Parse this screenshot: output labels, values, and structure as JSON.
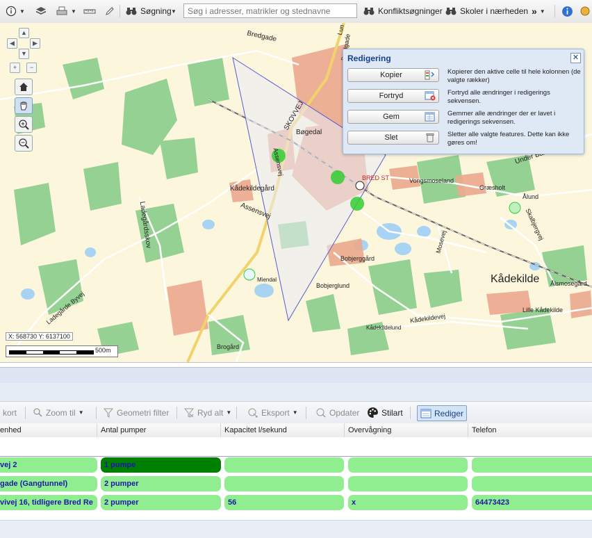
{
  "toolbar": {
    "search_label": "Søgning",
    "search_placeholder": "Søg i adresser, matrikler og stednavne",
    "conflict_label": "Konfliktsøgninger",
    "schools_label": "Skoler i nærheden",
    "more_label": "»"
  },
  "map": {
    "labels": {
      "bredgade": "Bredgade",
      "skovvej": "SKOVVEJ",
      "bogedal": "Bøgedal",
      "assensvej_v": "Assensvej",
      "bred_st": "BRED ST",
      "vongsmoseland": "Vongsmoseland",
      "graesholt": "Græsholt",
      "alund": "Ålund",
      "under_banken": "Under Banken",
      "kadekildegard": "Kådekildegård",
      "assensvej": "Assensvej",
      "ladegardsskov": "Ladegårdsskov",
      "kadekilde": "Kådekilde",
      "alsmosegard": "Ålsmosegård",
      "lille_kadekilde": "Lille Kådekilde",
      "bobjerggard": "Bobjerggård",
      "bobjerglund": "Bobjerglund",
      "miendal": "Miendal",
      "mosevej": "Mosevej",
      "ladegarde_byvej": "Ladegårde Byvej",
      "kadekildevej": "Kådekildevej",
      "kadekildelund": "Kådekildelund",
      "brogard": "Brogård",
      "skalbjergvej": "Skalbjergvej",
      "bredgade_n": "Bredgade",
      "lun": "Lun"
    },
    "coords": "X: 568730 Y: 6137100",
    "scale": "500m"
  },
  "edit_panel": {
    "title": "Redigering",
    "buttons": [
      {
        "label": "Kopier",
        "desc": "Kopierer den aktive celle til hele kolonnen (de valgte rækker)"
      },
      {
        "label": "Fortryd",
        "desc": "Fortryd alle ændringer i redigerings sekvensen."
      },
      {
        "label": "Gem",
        "desc": "Gemmer alle ændringer der er lavet i redigerings sekvensen."
      },
      {
        "label": "Slet",
        "desc": "Sletter alle valgte features. Dette kan ikke gøres om!"
      }
    ]
  },
  "grid_toolbar": {
    "kort": "kort",
    "zoom": "Zoom til",
    "geometri": "Geometri filter",
    "ryd": "Ryd alt",
    "eksport": "Eksport",
    "opdater": "Opdater",
    "stilart": "Stilart",
    "rediger": "Rediger"
  },
  "grid": {
    "headers": [
      "enhed",
      "Antal pumper",
      "Kapacitet l/sekund",
      "Overvågning",
      "Telefon"
    ],
    "rows": [
      [
        "vej 2",
        "1 pumpe",
        "",
        "",
        ""
      ],
      [
        "gade (Gangtunnel)",
        "2 pumper",
        "",
        "",
        ""
      ],
      [
        "vivej 16, tidligere Bred Re",
        "2 pumper",
        "56",
        "x",
        "64473423"
      ]
    ]
  },
  "colors": {
    "cell": "#90ee90",
    "cell_selected": "#008000",
    "cell_text": "#1a1aa8",
    "panel_title": "#15428b"
  }
}
